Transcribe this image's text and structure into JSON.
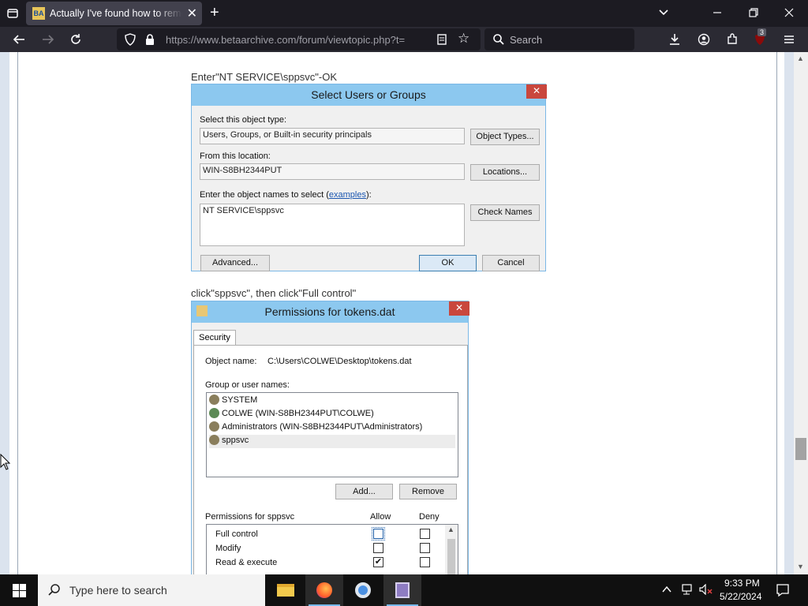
{
  "browser": {
    "tab_title": "Actually I've found how to remove",
    "favicon_text": "BA",
    "url": "https://www.betaarchive.com/forum/viewtopic.php?t=",
    "search_placeholder": "Search",
    "extension_badge": "3"
  },
  "post": {
    "caption1": "Enter\"NT SERVICE\\sppsvc\"-OK",
    "caption2": "click\"sppsvc\", then click\"Full control\""
  },
  "select_dialog": {
    "title": "Select Users or Groups",
    "object_type_label": "Select this object type:",
    "object_type_value": "Users, Groups, or Built-in security principals",
    "object_types_button": "Object Types...",
    "location_label": "From this location:",
    "location_value": "WIN-S8BH2344PUT",
    "locations_button": "Locations...",
    "names_label": "Enter the object names to select (",
    "names_link": "examples",
    "names_label_end": "):",
    "names_value": "NT SERVICE\\sppsvc",
    "check_names_button": "Check Names",
    "advanced_button": "Advanced...",
    "ok_button": "OK",
    "cancel_button": "Cancel"
  },
  "perm_dialog": {
    "title": "Permissions for tokens.dat",
    "tab": "Security",
    "object_name_label": "Object name:",
    "object_name_value": "C:\\Users\\COLWE\\Desktop\\tokens.dat",
    "group_label": "Group or user names:",
    "users": [
      "SYSTEM",
      "COLWE (WIN-S8BH2344PUT\\COLWE)",
      "Administrators (WIN-S8BH2344PUT\\Administrators)",
      "sppsvc"
    ],
    "add_button": "Add...",
    "remove_button": "Remove",
    "permissions_label": "Permissions for sppsvc",
    "allow_header": "Allow",
    "deny_header": "Deny",
    "permissions": [
      {
        "name": "Full control",
        "allow": false,
        "deny": false
      },
      {
        "name": "Modify",
        "allow": false,
        "deny": false
      },
      {
        "name": "Read & execute",
        "allow": true,
        "deny": false
      }
    ]
  },
  "taskbar": {
    "search_placeholder": "Type here to search",
    "time": "9:33 PM",
    "date": "5/22/2024"
  }
}
